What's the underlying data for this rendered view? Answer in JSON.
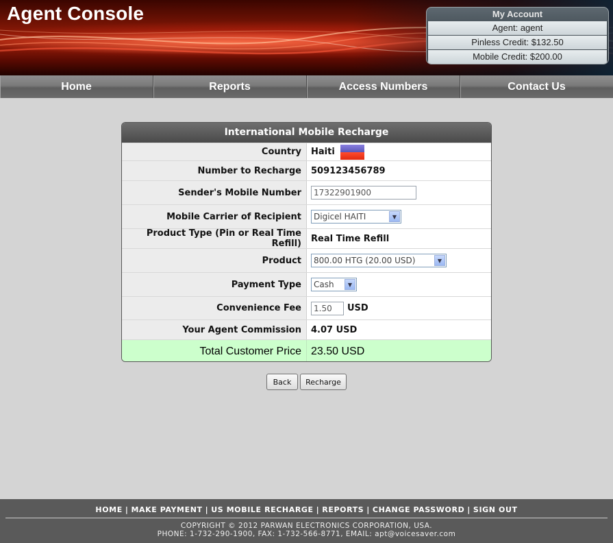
{
  "header": {
    "title": "Agent Console",
    "account": {
      "title": "My Account",
      "agent": "Agent: agent",
      "pinless_credit": "Pinless Credit: $132.50",
      "mobile_credit": "Mobile Credit: $200.00"
    }
  },
  "nav": [
    "Home",
    "Reports",
    "Access Numbers",
    "Contact Us"
  ],
  "form": {
    "title": "International Mobile Recharge",
    "country": {
      "label": "Country",
      "value": "Haiti"
    },
    "number": {
      "label": "Number to Recharge",
      "value": "509123456789"
    },
    "sender": {
      "label": "Sender's Mobile Number",
      "value": "17322901900"
    },
    "carrier": {
      "label": "Mobile Carrier of Recipient",
      "value": "Digicel HAITI"
    },
    "product_type": {
      "label": "Product Type (Pin or Real Time Refill)",
      "value": "Real Time Refill"
    },
    "product": {
      "label": "Product",
      "value": "800.00 HTG (20.00 USD)"
    },
    "payment": {
      "label": "Payment Type",
      "value": "Cash"
    },
    "fee": {
      "label": "Convenience Fee",
      "value": "1.50",
      "unit": "USD"
    },
    "commission": {
      "label": "Your Agent Commission",
      "value": "4.07 USD"
    },
    "total": {
      "label": "Total Customer Price",
      "value": "23.50 USD"
    }
  },
  "buttons": {
    "back": "Back",
    "recharge": "Recharge"
  },
  "footer": {
    "links": [
      "HOME",
      "MAKE PAYMENT",
      "US MOBILE RECHARGE",
      "REPORTS",
      "CHANGE PASSWORD",
      "SIGN OUT"
    ],
    "separator": "|",
    "copyright": "COPYRIGHT © 2012 PARWAN ELECTRONICS CORPORATION, USA.",
    "contact": "PHONE: 1-732-290-1900, FAX: 1-732-566-8771, EMAIL: apt@voicesaver.com"
  },
  "colors": {
    "total_bg": "#ccffcc",
    "nav_bg": "#7a7a7a",
    "footer_bg": "#5a5a5a"
  }
}
